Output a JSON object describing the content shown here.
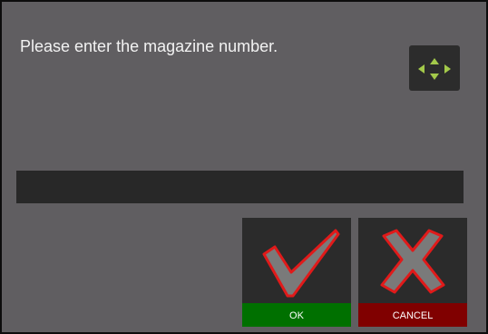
{
  "dialog": {
    "prompt": "Please enter the magazine number.",
    "input_value": "",
    "move_icon": "move-arrows-icon",
    "ok_label": "OK",
    "cancel_label": "CANCEL",
    "ok_icon": "checkmark-icon",
    "cancel_icon": "x-mark-icon"
  },
  "colors": {
    "dialog_background": "#605e61",
    "input_background": "#282828",
    "ok_accent": "#007000",
    "cancel_accent": "#800000",
    "icon_red": "#e01a1a",
    "move_arrows": "#a3c94a"
  }
}
